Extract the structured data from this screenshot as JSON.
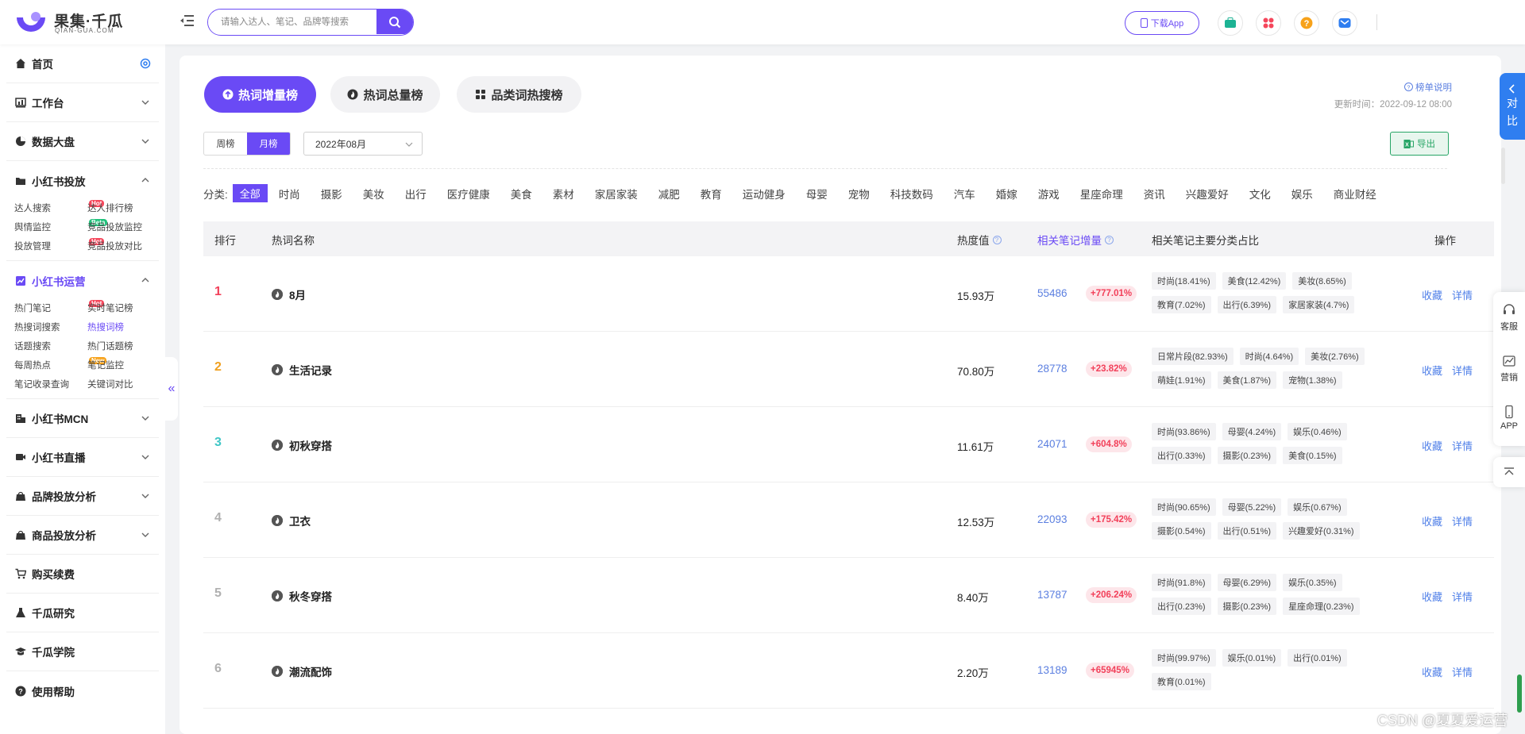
{
  "header": {
    "logo_text": "果集·千瓜",
    "logo_sub": "QIAN-GUA.COM",
    "search_placeholder": "请输入达人、笔记、品牌等搜索",
    "download_label": "下载App"
  },
  "sidebar": {
    "home": "首页",
    "workbench": "工作台",
    "dashboard": "数据大盘",
    "ads": "小红书投放",
    "ads_sub": [
      {
        "label": "达人搜索",
        "tag": "Hot"
      },
      {
        "label": "达人排行榜",
        "tag": "Hot"
      },
      {
        "label": "舆情监控",
        "tag": "Beta"
      },
      {
        "label": "竞品投放监控",
        "tag": ""
      },
      {
        "label": "投放管理",
        "tag": "Hot"
      },
      {
        "label": "竞品投放对比",
        "tag": ""
      }
    ],
    "ops": "小红书运营",
    "ops_sub": [
      {
        "label": "热门笔记",
        "tag": "Hot"
      },
      {
        "label": "实时笔记榜",
        "tag": "New"
      },
      {
        "label": "热搜词搜索",
        "tag": ""
      },
      {
        "label": "热搜词榜",
        "tag": ""
      },
      {
        "label": "话题搜索",
        "tag": ""
      },
      {
        "label": "热门话题榜",
        "tag": ""
      },
      {
        "label": "每周热点",
        "tag": "New"
      },
      {
        "label": "笔记监控",
        "tag": ""
      },
      {
        "label": "笔记收录查询",
        "tag": ""
      },
      {
        "label": "关键词对比",
        "tag": ""
      }
    ],
    "mcn": "小红书MCN",
    "live": "小红书直播",
    "brand": "品牌投放分析",
    "goods": "商品投放分析",
    "buy": "购买续费",
    "research": "千瓜研究",
    "academy": "千瓜学院",
    "help": "使用帮助",
    "collapse": "«"
  },
  "tabs": [
    "热词增量榜",
    "热词总量榜",
    "品类词热搜榜"
  ],
  "explain": "榜单说明",
  "updated": "更新时间：2022-09-12 08:00",
  "period": {
    "week": "周榜",
    "month": "月榜",
    "selected": "2022年08月"
  },
  "export": "导出",
  "categories_label": "分类:",
  "categories": [
    "全部",
    "时尚",
    "摄影",
    "美妆",
    "出行",
    "医疗健康",
    "美食",
    "素材",
    "家居家装",
    "减肥",
    "教育",
    "运动健身",
    "母婴",
    "宠物",
    "科技数码",
    "汽车",
    "婚嫁",
    "游戏",
    "星座命理",
    "资讯",
    "兴趣爱好",
    "文化",
    "娱乐",
    "商业财经"
  ],
  "table": {
    "headers": {
      "rank": "排行",
      "name": "热词名称",
      "heat": "热度值",
      "notes": "相关笔记增量",
      "share": "相关笔记主要分类占比",
      "ops": "操作"
    },
    "fav": "收藏",
    "detail": "详情",
    "rows": [
      {
        "rank": "1",
        "name": "8月",
        "heat": "15.93万",
        "notes": "55486",
        "growth": "+777.01%",
        "shares": [
          "时尚(18.41%)",
          "美食(12.42%)",
          "美妆(8.65%)",
          "教育(7.02%)",
          "出行(6.39%)",
          "家居家装(4.7%)"
        ]
      },
      {
        "rank": "2",
        "name": "生活记录",
        "heat": "70.80万",
        "notes": "28778",
        "growth": "+23.82%",
        "shares": [
          "日常片段(82.93%)",
          "时尚(4.64%)",
          "美妆(2.76%)",
          "萌娃(1.91%)",
          "美食(1.87%)",
          "宠物(1.38%)"
        ]
      },
      {
        "rank": "3",
        "name": "初秋穿搭",
        "heat": "11.61万",
        "notes": "24071",
        "growth": "+604.8%",
        "shares": [
          "时尚(93.86%)",
          "母婴(4.24%)",
          "娱乐(0.46%)",
          "出行(0.33%)",
          "摄影(0.23%)",
          "美食(0.15%)"
        ]
      },
      {
        "rank": "4",
        "name": "卫衣",
        "heat": "12.53万",
        "notes": "22093",
        "growth": "+175.42%",
        "shares": [
          "时尚(90.65%)",
          "母婴(5.22%)",
          "娱乐(0.67%)",
          "摄影(0.54%)",
          "出行(0.51%)",
          "兴趣爱好(0.31%)"
        ]
      },
      {
        "rank": "5",
        "name": "秋冬穿搭",
        "heat": "8.40万",
        "notes": "13787",
        "growth": "+206.24%",
        "shares": [
          "时尚(91.8%)",
          "母婴(6.29%)",
          "娱乐(0.35%)",
          "出行(0.23%)",
          "摄影(0.23%)",
          "星座命理(0.23%)"
        ]
      },
      {
        "rank": "6",
        "name": "潮流配饰",
        "heat": "2.20万",
        "notes": "13189",
        "growth": "+65945%",
        "shares": [
          "时尚(99.97%)",
          "娱乐(0.01%)",
          "出行(0.01%)",
          "教育(0.01%)"
        ]
      }
    ]
  },
  "right_panel": {
    "compare": [
      "对",
      "比"
    ],
    "service": "客服",
    "marketing": "营销",
    "app": "APP"
  },
  "watermark": "CSDN @夏夏爱运营",
  "colors": {
    "brand": "#6a4af5",
    "rank1": "#f2405a",
    "rank2": "#f0a020",
    "rank3": "#3fc6c6",
    "rank_other": "#b0b0b0"
  }
}
